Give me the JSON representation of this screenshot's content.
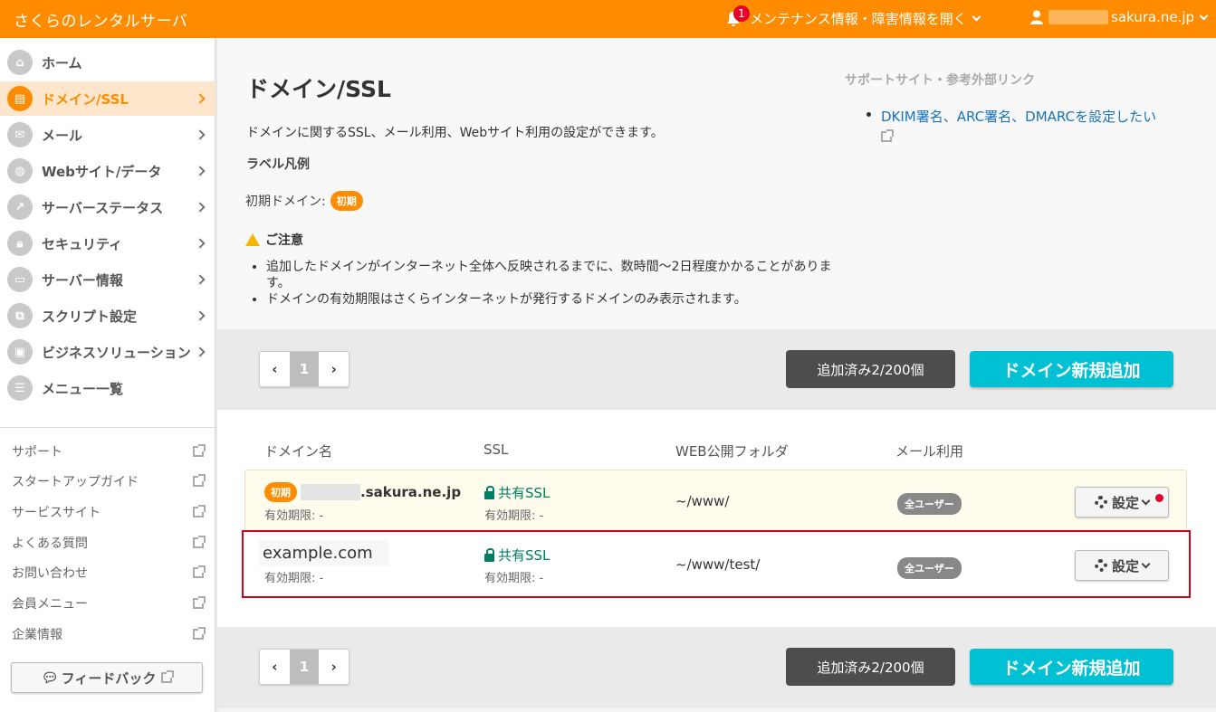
{
  "header": {
    "brand": "さくらのレンタルサーバ",
    "notification_count": "1",
    "maintenance_label": "メンテナンス情報・障害情報を開く",
    "user_domain": "sakura.ne.jp"
  },
  "sidebar": {
    "items": [
      {
        "label": "ホーム",
        "icon": "home-icon"
      },
      {
        "label": "ドメイン/SSL",
        "icon": "domain-icon"
      },
      {
        "label": "メール",
        "icon": "mail-icon"
      },
      {
        "label": "Webサイト/データ",
        "icon": "globe-icon"
      },
      {
        "label": "サーバーステータス",
        "icon": "chart-icon"
      },
      {
        "label": "セキュリティ",
        "icon": "lock-icon"
      },
      {
        "label": "サーバー情報",
        "icon": "server-icon"
      },
      {
        "label": "スクリプト設定",
        "icon": "script-icon"
      },
      {
        "label": "ビジネスソリューション",
        "icon": "briefcase-icon"
      },
      {
        "label": "メニュー一覧",
        "icon": "list-icon"
      }
    ],
    "links": [
      "サポート",
      "スタートアップガイド",
      "サービスサイト",
      "よくある質問",
      "お問い合わせ",
      "会員メニュー",
      "企業情報"
    ],
    "feedback": "フィードバック"
  },
  "main": {
    "title": "ドメイン/SSL",
    "description": "ドメインに関するSSL、メール利用、Webサイト利用の設定ができます。",
    "legend_title": "ラベル凡例",
    "legend_label": "初期ドメイン:",
    "legend_tag": "初期",
    "caution_title": "ご注意",
    "cautions": [
      "追加したドメインがインターネット全体へ反映されるまでに、数時間〜2日程度かかることがあります。",
      "ドメインの有効期限はさくらインターネットが発行するドメインのみ表示されます。"
    ],
    "support_title": "サポートサイト・参考外部リンク",
    "support_link": "DKIM署名、ARC署名、DMARCを設定したい"
  },
  "toolbar": {
    "page": "1",
    "count": "追加済み2/200個",
    "add_label": "ドメイン新規追加"
  },
  "table": {
    "headers": [
      "ドメイン名",
      "SSL",
      "WEB公開フォルダ",
      "メール利用"
    ],
    "rows": [
      {
        "tag": "初期",
        "domain": ".sakura.ne.jp",
        "expiry": "有効期限: -",
        "ssl": "共有SSL",
        "ssl_expiry": "有効期限: -",
        "folder": "~/www/",
        "mail": "全ユーザー",
        "settings": "設定"
      },
      {
        "domain": "example.com",
        "expiry": "有効期限: -",
        "ssl": "共有SSL",
        "ssl_expiry": "有効期限: -",
        "folder": "~/www/test/",
        "mail": "全ユーザー",
        "settings": "設定"
      }
    ]
  },
  "colors": {
    "brand": "#ff8c00",
    "add_button": "#00c1d4",
    "ssl": "#007d63",
    "highlight": "#d0021b"
  }
}
